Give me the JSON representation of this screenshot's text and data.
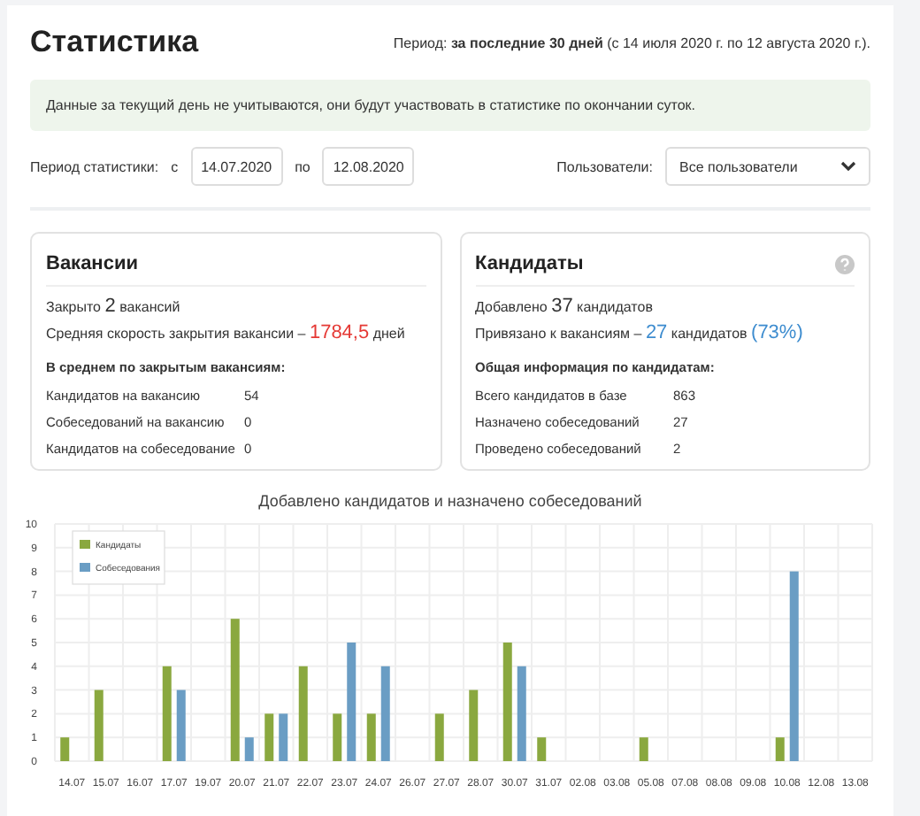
{
  "header": {
    "title": "Статистика",
    "period_label": "Период:",
    "period_value": "за последние 30 дней",
    "period_range": "(с 14 июля 2020 г. по 12 августа 2020 г.)."
  },
  "notice": "Данные за текущий день не учитываются, они будут участвовать в статистике по окончании суток.",
  "filters": {
    "period_label": "Период статистики:",
    "from_label": "с",
    "from": "14.07.2020",
    "to_label": "по",
    "to": "12.08.2020",
    "users_label": "Пользователи:",
    "users_value": "Все пользователи"
  },
  "vacancies": {
    "title": "Вакансии",
    "closed_prefix": "Закрыто",
    "closed_count": "2",
    "closed_suffix": "вакансий",
    "speed_prefix": "Средняя скорость закрытия вакансии –",
    "speed_value": "1784,5",
    "speed_suffix": "дней",
    "subtitle": "В среднем по закрытым вакансиям:",
    "rows": [
      {
        "label": "Кандидатов на вакансию",
        "value": "54"
      },
      {
        "label": "Собеседований на вакансию",
        "value": "0"
      },
      {
        "label": "Кандидатов на собеседование",
        "value": "0"
      }
    ]
  },
  "candidates": {
    "title": "Кандидаты",
    "added_prefix": "Добавлено",
    "added_count": "37",
    "added_suffix": "кандидатов",
    "linked_prefix": "Привязано к вакансиям –",
    "linked_count": "27",
    "linked_suffix": "кандидатов",
    "linked_percent": "(73%)",
    "subtitle": "Общая информация по кандидатам:",
    "rows": [
      {
        "label": "Всего кандидатов в базе",
        "value": "863"
      },
      {
        "label": "Назначено собеседований",
        "value": "27"
      },
      {
        "label": "Проведено собеседований",
        "value": "2"
      }
    ]
  },
  "chart": {
    "chart_data": {
      "type": "bar",
      "title": "Добавлено кандидатов и назначено собеседований",
      "categories": [
        "14.07",
        "15.07",
        "16.07",
        "17.07",
        "19.07",
        "20.07",
        "21.07",
        "22.07",
        "23.07",
        "24.07",
        "26.07",
        "27.07",
        "28.07",
        "30.07",
        "31.07",
        "02.08",
        "03.08",
        "05.08",
        "07.08",
        "08.08",
        "09.08",
        "10.08",
        "12.08",
        "13.08"
      ],
      "ylim": [
        0,
        10
      ],
      "grid": true,
      "legend": true,
      "yticks": [
        0,
        1,
        2,
        3,
        4,
        5,
        6,
        7,
        8,
        9,
        10
      ],
      "series": [
        {
          "name": "Кандидаты",
          "color": "#8aa83f",
          "values": [
            1,
            3,
            0,
            4,
            0,
            6,
            2,
            4,
            2,
            2,
            0,
            2,
            3,
            5,
            1,
            0,
            0,
            1,
            0,
            0,
            0,
            1,
            0,
            0
          ]
        },
        {
          "name": "Собеседования",
          "color": "#6a9dc4",
          "values": [
            0,
            0,
            0,
            3,
            0,
            1,
            2,
            0,
            5,
            4,
            0,
            0,
            0,
            4,
            0,
            0,
            0,
            0,
            0,
            0,
            0,
            8,
            0,
            0
          ]
        }
      ]
    }
  }
}
